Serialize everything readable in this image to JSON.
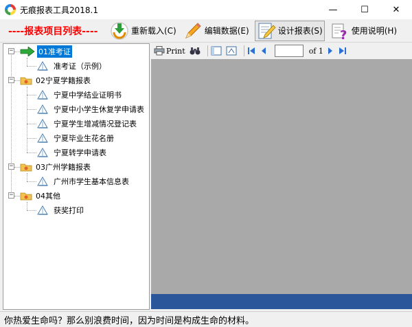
{
  "window": {
    "title": "无痕报表工具2018.1",
    "minimize": "—",
    "maximize": "☐",
    "close": "✕"
  },
  "toolbar": {
    "title": "----报表项目列表----",
    "reload": "重新载入(C)",
    "edit_data": "编辑数据(E)",
    "design": "设计报表(S)",
    "help": "使用说明(H)"
  },
  "tree": {
    "g1": "01准考证",
    "g1_items": [
      "准考证（示例）"
    ],
    "g2": "02宁夏学籍报表",
    "g2_items": [
      "宁夏中学结业证明书",
      "宁夏中小学生休复学申请表",
      "宁夏学生增减情况登记表",
      "宁夏毕业生花名册",
      "宁夏转学申请表"
    ],
    "g3": "03广州学籍报表",
    "g3_items": [
      "广州市学生基本信息表"
    ],
    "g4": "04其他",
    "g4_items": [
      "获奖打印"
    ],
    "expanded_symbol": "−"
  },
  "viewer": {
    "print_label": "Print",
    "page_value": "",
    "of_label": "of 1"
  },
  "status": {
    "text": "你热爱生命吗？那么别浪费时间，因为时间是构成生命的材料。"
  },
  "colors": {
    "accent_red": "#ff0000",
    "selection": "#0078d7",
    "viewer_bg": "#a9a9a9",
    "viewer_bottom": "#2b579a"
  }
}
